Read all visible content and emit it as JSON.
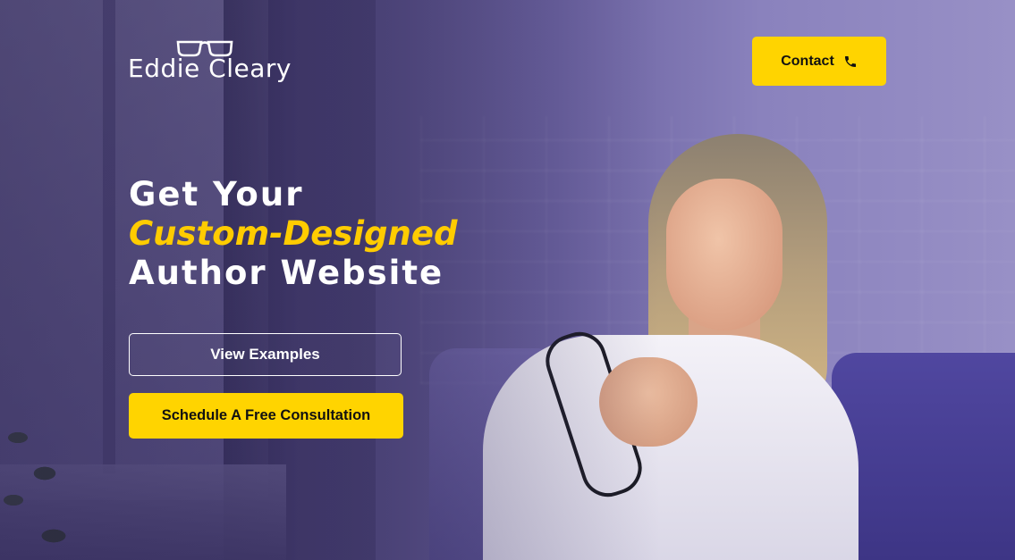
{
  "brand": {
    "name": "Eddie Cleary",
    "logo_icon": "eyeglasses-icon"
  },
  "header": {
    "contact_label": "Contact",
    "contact_icon": "phone-icon"
  },
  "hero": {
    "line1": "Get Your",
    "line2": "Custom-Designed",
    "line3": "Author Website"
  },
  "actions": {
    "view_examples": "View Examples",
    "schedule": "Schedule A Free Consultation"
  },
  "colors": {
    "accent": "#ffd400",
    "headline_accent": "#ffcc00",
    "text": "#ffffff",
    "overlay": "#4e4679"
  }
}
